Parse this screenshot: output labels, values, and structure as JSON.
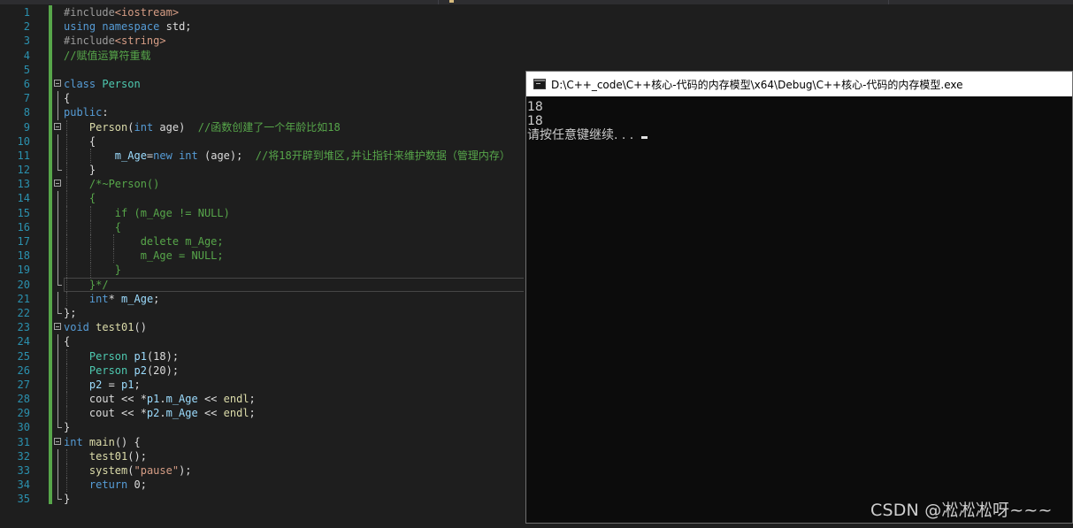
{
  "editor": {
    "line_numbers": [
      "1",
      "2",
      "3",
      "4",
      "5",
      "6",
      "7",
      "8",
      "9",
      "10",
      "11",
      "12",
      "13",
      "14",
      "15",
      "16",
      "17",
      "18",
      "19",
      "20",
      "21",
      "22",
      "23",
      "24",
      "25",
      "26",
      "27",
      "28",
      "29",
      "30",
      "31",
      "32",
      "33",
      "34",
      "35"
    ],
    "lines": [
      [
        [
          "pp",
          "#include"
        ],
        [
          "st",
          "<iostream>"
        ]
      ],
      [
        [
          "kw",
          "using"
        ],
        [
          "pl",
          " "
        ],
        [
          "kw",
          "namespace"
        ],
        [
          "pl",
          " std;"
        ]
      ],
      [
        [
          "pp",
          "#include"
        ],
        [
          "st",
          "<string>"
        ]
      ],
      [
        [
          "cm",
          "//赋值运算符重载"
        ]
      ],
      [],
      [
        [
          "kw",
          "class"
        ],
        [
          "pl",
          " "
        ],
        [
          "ty",
          "Person"
        ]
      ],
      [
        [
          "pl",
          "{"
        ]
      ],
      [
        [
          "kw",
          "public"
        ],
        [
          "pl",
          ":"
        ]
      ],
      [
        [
          "pl",
          "    "
        ],
        [
          "fn",
          "Person"
        ],
        [
          "pl",
          "("
        ],
        [
          "kw",
          "int"
        ],
        [
          "pl",
          " age)  "
        ],
        [
          "cm",
          "//函数创建了一个年龄比如18"
        ]
      ],
      [
        [
          "pl",
          "    {"
        ]
      ],
      [
        [
          "pl",
          "        "
        ],
        [
          "va",
          "m_Age"
        ],
        [
          "pl",
          "="
        ],
        [
          "kw",
          "new"
        ],
        [
          "pl",
          " "
        ],
        [
          "kw",
          "int"
        ],
        [
          "pl",
          " (age);  "
        ],
        [
          "cm",
          "//将18开辟到堆区,并让指针来维护数据（管理内存）"
        ]
      ],
      [
        [
          "pl",
          "    }"
        ]
      ],
      [
        [
          "pl",
          "    "
        ],
        [
          "cm",
          "/*~Person()"
        ]
      ],
      [
        [
          "cm",
          "    {"
        ]
      ],
      [
        [
          "cm",
          "        if (m_Age != NULL)"
        ]
      ],
      [
        [
          "cm",
          "        {"
        ]
      ],
      [
        [
          "cm",
          "            delete m_Age;"
        ]
      ],
      [
        [
          "cm",
          "            m_Age = NULL;"
        ]
      ],
      [
        [
          "cm",
          "        }"
        ]
      ],
      [
        [
          "cm",
          "    }*/"
        ]
      ],
      [
        [
          "pl",
          "    "
        ],
        [
          "kw",
          "int"
        ],
        [
          "pl",
          "* "
        ],
        [
          "va",
          "m_Age"
        ],
        [
          "pl",
          ";"
        ]
      ],
      [
        [
          "pl",
          "};"
        ]
      ],
      [
        [
          "kw",
          "void"
        ],
        [
          "pl",
          " "
        ],
        [
          "fn",
          "test01"
        ],
        [
          "pl",
          "()"
        ]
      ],
      [
        [
          "pl",
          "{"
        ]
      ],
      [
        [
          "pl",
          "    "
        ],
        [
          "ty",
          "Person"
        ],
        [
          "pl",
          " "
        ],
        [
          "va",
          "p1"
        ],
        [
          "pl",
          "(18);"
        ]
      ],
      [
        [
          "pl",
          "    "
        ],
        [
          "ty",
          "Person"
        ],
        [
          "pl",
          " "
        ],
        [
          "va",
          "p2"
        ],
        [
          "pl",
          "(20);"
        ]
      ],
      [
        [
          "pl",
          "    "
        ],
        [
          "va",
          "p2"
        ],
        [
          "pl",
          " = "
        ],
        [
          "va",
          "p1"
        ],
        [
          "pl",
          ";"
        ]
      ],
      [
        [
          "pl",
          "    cout << *"
        ],
        [
          "va",
          "p1"
        ],
        [
          "pl",
          "."
        ],
        [
          "va",
          "m_Age"
        ],
        [
          "pl",
          " << "
        ],
        [
          "fn",
          "endl"
        ],
        [
          "pl",
          ";"
        ]
      ],
      [
        [
          "pl",
          "    cout << *"
        ],
        [
          "va",
          "p2"
        ],
        [
          "pl",
          "."
        ],
        [
          "va",
          "m_Age"
        ],
        [
          "pl",
          " << "
        ],
        [
          "fn",
          "endl"
        ],
        [
          "pl",
          ";"
        ]
      ],
      [
        [
          "pl",
          "}"
        ]
      ],
      [
        [
          "kw",
          "int"
        ],
        [
          "pl",
          " "
        ],
        [
          "fn",
          "main"
        ],
        [
          "pl",
          "() {"
        ]
      ],
      [
        [
          "pl",
          "    "
        ],
        [
          "fn",
          "test01"
        ],
        [
          "pl",
          "();"
        ]
      ],
      [
        [
          "pl",
          "    "
        ],
        [
          "fn",
          "system"
        ],
        [
          "pl",
          "("
        ],
        [
          "st",
          "\"pause\""
        ],
        [
          "pl",
          ");"
        ]
      ],
      [
        [
          "pl",
          "    "
        ],
        [
          "kw",
          "return"
        ],
        [
          "pl",
          " 0;"
        ]
      ],
      [
        [
          "pl",
          "}"
        ]
      ]
    ]
  },
  "console": {
    "title": "D:\\C++_code\\C++核心-代码的内存模型\\x64\\Debug\\C++核心-代码的内存模型.exe",
    "output": [
      "18",
      "18",
      "请按任意键继续. . . "
    ]
  },
  "watermark": "CSDN @凇凇凇呀~~~"
}
